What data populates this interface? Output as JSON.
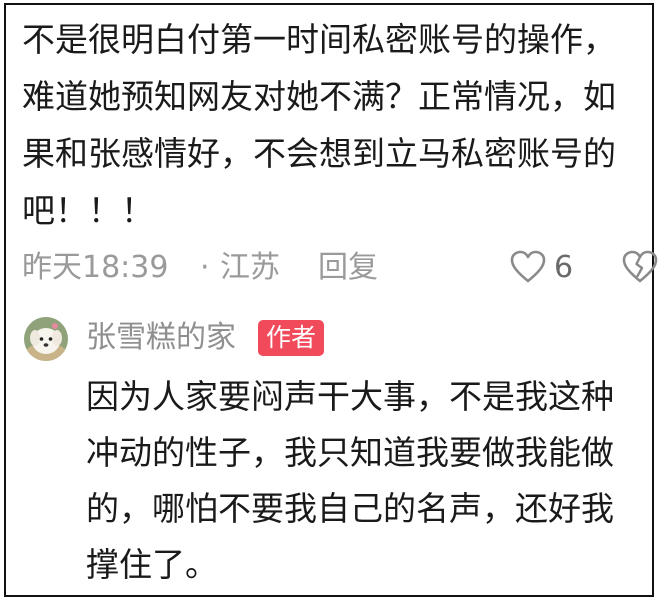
{
  "comment": {
    "text": "不是很明白付第一时间私密账号的操作，难道她预知网友对她不满？正常情况，如果和张感情好，不会想到立马私密账号的吧！！！",
    "time": "昨天18:39",
    "separator": "·",
    "location": "江苏",
    "reply_label": "回复",
    "like_count": "6"
  },
  "reply": {
    "author_name": "张雪糕的家",
    "author_tag": "作者",
    "text": "因为人家要闷声干大事，不是我这种冲动的性子，我只知道我要做我能做的，哪怕不要我自己的名声，还好我撑住了。"
  },
  "colors": {
    "text": "#1a1a1a",
    "meta": "#9a9a9a",
    "tag_bg": "#f04a5b"
  },
  "icons": {
    "like": "heart-outline-icon",
    "dislike": "broken-heart-icon",
    "avatar": "dog-avatar"
  }
}
